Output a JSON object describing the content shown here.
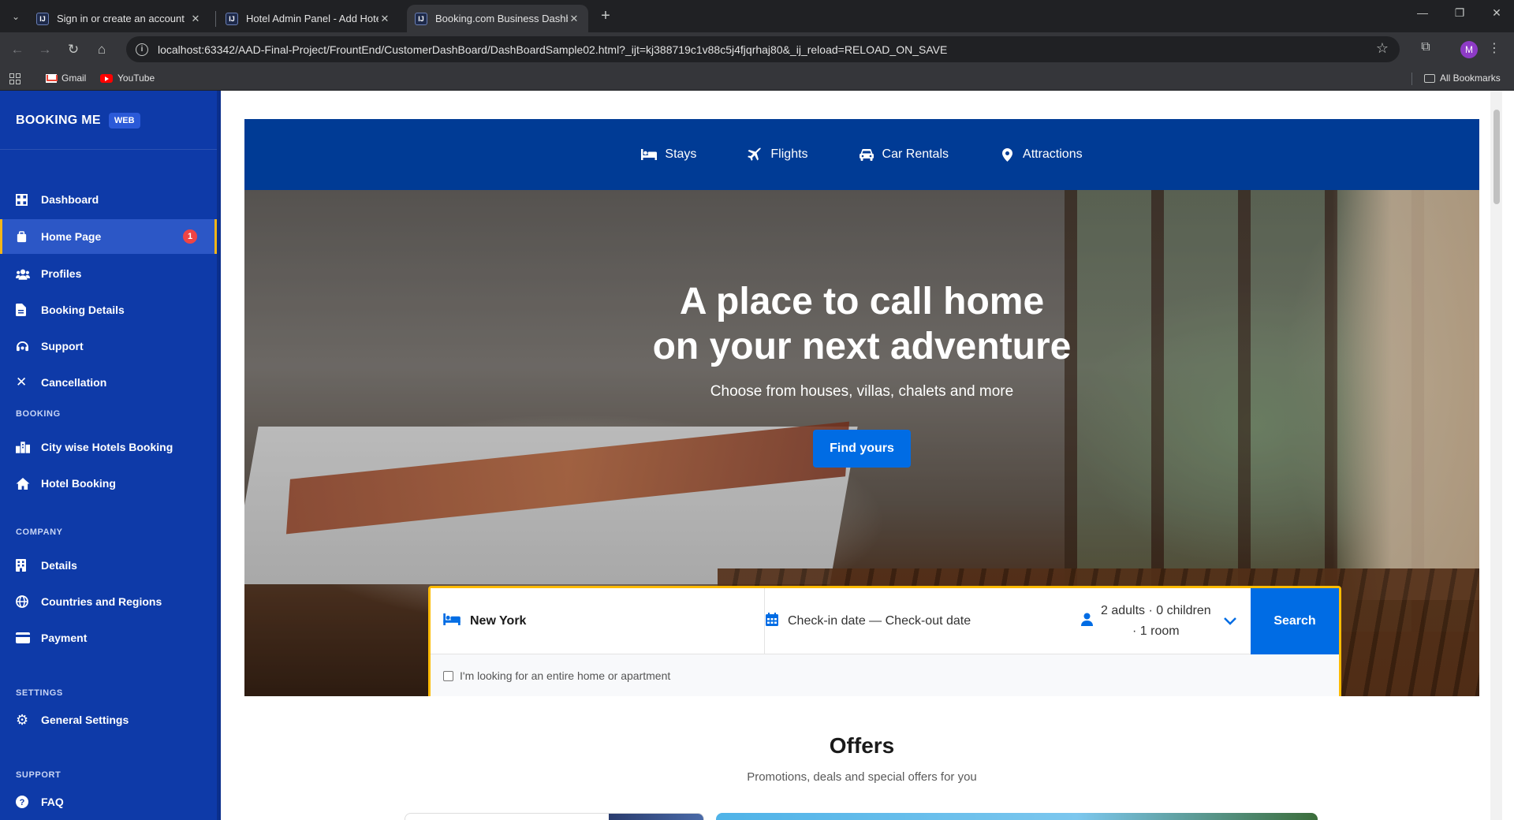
{
  "browser": {
    "tabs": [
      {
        "title": "Sign in or create an account",
        "favicon": "IJ"
      },
      {
        "title": "Hotel Admin Panel - Add Hotel",
        "favicon": "IJ"
      },
      {
        "title": "Booking.com Business Dashboa",
        "favicon": "IJ"
      }
    ],
    "url": "localhost:63342/AAD-Final-Project/FrountEnd/CustomerDashBoard/DashBoardSample02.html?_ijt=kj388719c1v88c5j4fjqrhaj80&_ij_reload=RELOAD_ON_SAVE",
    "profile_initial": "M",
    "bookmarks": [
      {
        "label": "Gmail",
        "icon": "gmail-icon"
      },
      {
        "label": "YouTube",
        "icon": "youtube-icon"
      }
    ],
    "all_bookmarks": "All Bookmarks"
  },
  "sidebar": {
    "brand": "BOOKING ME",
    "brand_badge": "WEB",
    "items_main": [
      {
        "label": "Dashboard",
        "icon": "dashboard-icon"
      },
      {
        "label": "Home Page",
        "icon": "home-page-icon",
        "badge": "1",
        "active": true
      },
      {
        "label": "Profiles",
        "icon": "users-icon"
      },
      {
        "label": "Booking Details",
        "icon": "file-icon"
      },
      {
        "label": "Support",
        "icon": "support-icon"
      },
      {
        "label": "Cancellation",
        "icon": "close-icon"
      }
    ],
    "section_booking": "BOOKING",
    "items_booking": [
      {
        "label": "City wise Hotels Booking",
        "icon": "city-icon"
      },
      {
        "label": "Hotel Booking",
        "icon": "home-icon"
      }
    ],
    "section_company": "COMPANY",
    "items_company": [
      {
        "label": "Details",
        "icon": "building-icon"
      },
      {
        "label": "Countries and Regions",
        "icon": "globe-icon"
      },
      {
        "label": "Payment",
        "icon": "credit-card-icon"
      }
    ],
    "section_settings": "SETTINGS",
    "items_settings": [
      {
        "label": "General Settings",
        "icon": "gear-icon"
      }
    ],
    "section_support": "SUPPORT",
    "items_support": [
      {
        "label": "FAQ",
        "icon": "question-icon"
      }
    ]
  },
  "topnav": [
    {
      "label": "Stays",
      "icon": "bed-icon"
    },
    {
      "label": "Flights",
      "icon": "plane-icon"
    },
    {
      "label": "Car Rentals",
      "icon": "car-icon"
    },
    {
      "label": "Attractions",
      "icon": "map-pin-icon"
    }
  ],
  "hero": {
    "title_line1": "A place to call home",
    "title_line2": "on your next adventure",
    "subtitle": "Choose from houses, villas, chalets and more",
    "cta": "Find yours"
  },
  "search": {
    "destination": "New York",
    "dates": "Check-in date — Check-out date",
    "guests_line1": "2 adults · 0 children",
    "guests_line2": "· 1 room",
    "button": "Search",
    "checkbox_label": "I'm looking for an entire home or apartment",
    "checkbox_checked": false
  },
  "offers": {
    "title": "Offers",
    "subtitle": "Promotions, deals and special offers for you"
  },
  "colors": {
    "sidebar": "#0e3aa8",
    "topnav": "#003b95",
    "accent": "#006ce4",
    "highlight": "#febb02",
    "badge": "#ef4444"
  }
}
